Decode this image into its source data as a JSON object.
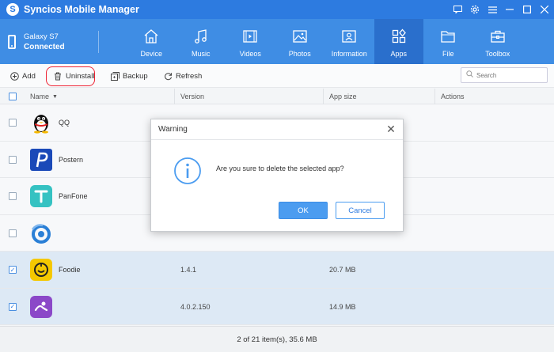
{
  "app": {
    "title": "Syncios Mobile Manager",
    "logo_letter": "S"
  },
  "device": {
    "name": "Galaxy S7",
    "status": "Connected"
  },
  "nav": {
    "tabs": [
      {
        "label": "Device",
        "icon": "home-icon"
      },
      {
        "label": "Music",
        "icon": "music-icon"
      },
      {
        "label": "Videos",
        "icon": "video-icon"
      },
      {
        "label": "Photos",
        "icon": "photo-icon"
      },
      {
        "label": "Information",
        "icon": "contact-card-icon"
      },
      {
        "label": "Apps",
        "icon": "apps-icon",
        "active": true
      },
      {
        "label": "File",
        "icon": "folder-icon"
      },
      {
        "label": "Toolbox",
        "icon": "toolbox-icon"
      }
    ]
  },
  "toolbar": {
    "add_label": "Add",
    "uninstall_label": "Uninstall",
    "backup_label": "Backup",
    "refresh_label": "Refresh",
    "search_placeholder": "Search"
  },
  "table": {
    "headers": {
      "name": "Name",
      "version": "Version",
      "size": "App size",
      "actions": "Actions"
    },
    "rows": [
      {
        "name": "QQ",
        "version": "",
        "size": "",
        "checked": false,
        "icon": "qq-penguin-icon"
      },
      {
        "name": "Postern",
        "version": "",
        "size": "",
        "checked": false,
        "icon": "postern-app-icon"
      },
      {
        "name": "PanFone",
        "version": "",
        "size": "",
        "checked": false,
        "icon": "panfone-app-icon"
      },
      {
        "name": "",
        "version": "",
        "size": "",
        "checked": false,
        "icon": "blurred-app-icon"
      },
      {
        "name": "Foodie",
        "version": "1.4.1",
        "size": "20.7 MB",
        "checked": true,
        "icon": "foodie-app-icon"
      },
      {
        "name": "",
        "version": "4.0.2.150",
        "size": "14.9 MB",
        "checked": true,
        "icon": "purple-app-icon"
      }
    ]
  },
  "status": {
    "summary": "2 of 21 item(s), 35.6 MB"
  },
  "dialog": {
    "title": "Warning",
    "message": "Are you sure to delete the selected app?",
    "ok_label": "OK",
    "cancel_label": "Cancel",
    "close_glyph": "✕"
  },
  "colors": {
    "titlebar": "#2d7be0",
    "navbar": "#3f8de4",
    "nav_active": "#2a6fcc",
    "selected_row": "#dde9f5",
    "ok_button": "#4b9cf0",
    "highlight_ring": "#e22233"
  }
}
